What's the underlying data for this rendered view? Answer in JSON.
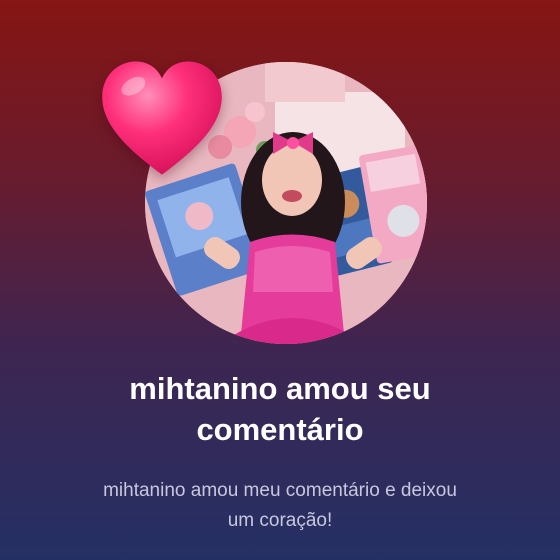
{
  "notification": {
    "title": "mihtanino amou seu comentário",
    "subtitle": "mihtanino amou meu comentário e deixou um coração!"
  },
  "icons": {
    "reaction": "heart-icon"
  },
  "colors": {
    "background_top": "#861513",
    "background_bottom": "#243064",
    "heart": "#ff2f7a",
    "title_text": "#ffffff",
    "subtitle_text": "#c9c7de"
  }
}
